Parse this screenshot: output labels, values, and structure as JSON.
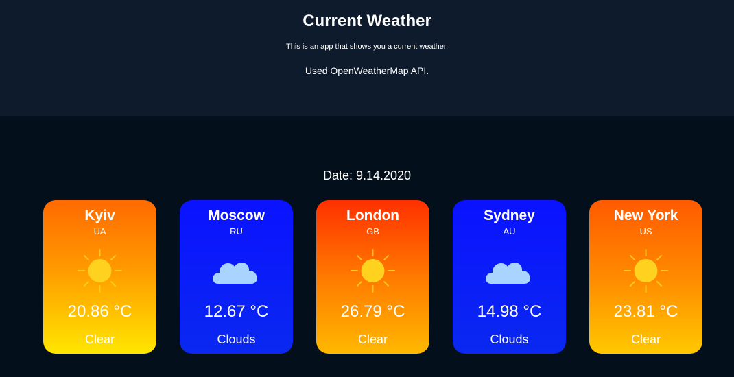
{
  "header": {
    "title": "Current Weather",
    "subtitle": "This is an app that shows you a current weather.",
    "api_note": "Used OpenWeatherMap API."
  },
  "date_label": "Date: 9.14.2020",
  "colors": {
    "header_bg": "#0e1b2d",
    "page_bg": "#030f1a",
    "clear_card": "#ff8a00",
    "clouds_card": "#0a1aff",
    "sun": "#ffd21f",
    "cloud": "#a8d4ff"
  },
  "cards": [
    {
      "city": "Kyiv",
      "country": "UA",
      "temp": "20.86 °C",
      "desc": "Clear",
      "icon": "sun-icon"
    },
    {
      "city": "Moscow",
      "country": "RU",
      "temp": "12.67 °C",
      "desc": "Clouds",
      "icon": "cloud-icon"
    },
    {
      "city": "London",
      "country": "GB",
      "temp": "26.79 °C",
      "desc": "Clear",
      "icon": "sun-icon"
    },
    {
      "city": "Sydney",
      "country": "AU",
      "temp": "14.98 °C",
      "desc": "Clouds",
      "icon": "cloud-icon"
    },
    {
      "city": "New York",
      "country": "US",
      "temp": "23.81 °C",
      "desc": "Clear",
      "icon": "sun-icon"
    }
  ]
}
